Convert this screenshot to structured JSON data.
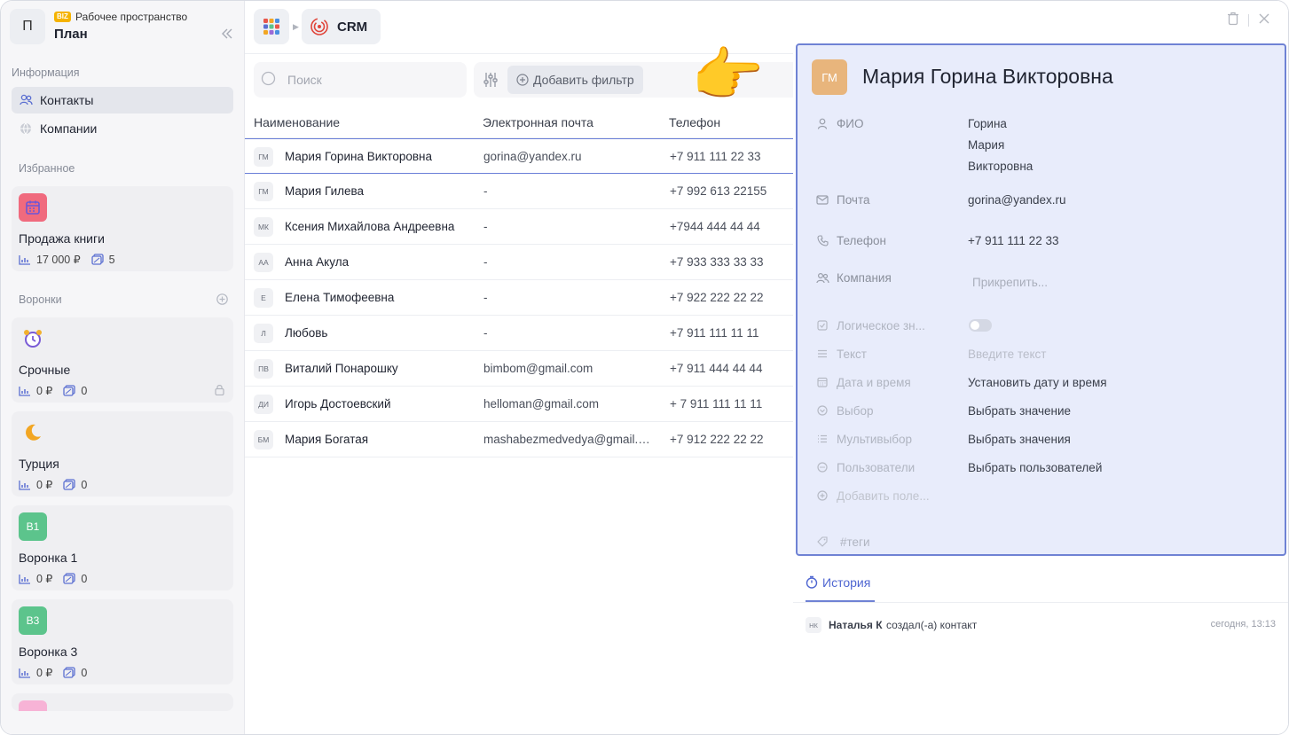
{
  "workspace": {
    "avatar": "П",
    "badge": "BIZ",
    "label": "Рабочее пространство",
    "name": "План"
  },
  "sidebar": {
    "info_title": "Информация",
    "nav": [
      {
        "label": "Контакты",
        "icon": "contacts-icon",
        "active": true
      },
      {
        "label": "Компании",
        "icon": "globe-icon",
        "active": false
      }
    ],
    "fav_title": "Избранное",
    "favorites": [
      {
        "title": "Продажа книги",
        "icon": "calendar-icon",
        "amount": "17 000 ₽",
        "count": "5"
      }
    ],
    "funnels_title": "Воронки",
    "funnels": [
      {
        "title": "Срочные",
        "icon": "alarm-clock-icon",
        "amount": "0 ₽",
        "count": "0",
        "locked": true
      },
      {
        "title": "Турция",
        "icon": "crescent-moon-icon",
        "amount": "0 ₽",
        "count": "0"
      },
      {
        "title": "Воронка 1",
        "badge": "В1",
        "amount": "0 ₽",
        "count": "0"
      },
      {
        "title": "Воронка 3",
        "badge": "В3",
        "amount": "0 ₽",
        "count": "0"
      }
    ]
  },
  "header": {
    "crm_label": "CRM"
  },
  "toolbar": {
    "search_placeholder": "Поиск",
    "add_filter": "Добавить фильтр"
  },
  "table": {
    "columns": [
      "Наименование",
      "Электронная почта",
      "Телефон"
    ],
    "rows": [
      {
        "ini": "ГМ",
        "name": "Мария Горина Викторовна",
        "email": "gorina@yandex.ru",
        "phone": "+7 911 111 22 33"
      },
      {
        "ini": "ГМ",
        "name": "Мария Гилева",
        "email": "-",
        "phone": "+7 992 613 22155"
      },
      {
        "ini": "МК",
        "name": "Ксения Михайлова Андреевна",
        "email": "-",
        "phone": "+7944 444 44 44"
      },
      {
        "ini": "АА",
        "name": "Анна Акула",
        "email": "-",
        "phone": "+7 933 333 33 33"
      },
      {
        "ini": "Е",
        "name": "Елена Тимофеевна",
        "email": "-",
        "phone": "+7 922 222 22 22"
      },
      {
        "ini": "Л",
        "name": "Любовь",
        "email": "-",
        "phone": "+7 911 111 11 11"
      },
      {
        "ini": "ПВ",
        "name": "Виталий Понарошку",
        "email": "bimbom@gmail.com",
        "phone": "+7 911 444 44 44"
      },
      {
        "ini": "ДИ",
        "name": "Игорь Достоевский",
        "email": "helloman@gmail.com",
        "phone": "+ 7 911 111 11 11"
      },
      {
        "ini": "БМ",
        "name": "Мария Богатая",
        "email": "mashabezmedvedya@gmail.com",
        "phone": "+7 912 222 22 22"
      }
    ]
  },
  "detail": {
    "avatar": "ГМ",
    "title": "Мария Горина Викторовна",
    "fio_label": "ФИО",
    "fio": [
      "Горина",
      "Мария",
      "Викторовна"
    ],
    "email_label": "Почта",
    "email": "gorina@yandex.ru",
    "phone_label": "Телефон",
    "phone": "+7 911 111 22 33",
    "company_label": "Компания",
    "company_action": "Прикрепить...",
    "bool_label": "Логическое зн...",
    "text_label": "Текст",
    "text_placeholder": "Введите текст",
    "datetime_label": "Дата и время",
    "datetime_action": "Установить дату и время",
    "select_label": "Выбор",
    "select_action": "Выбрать значение",
    "multiselect_label": "Мультивыбор",
    "multiselect_action": "Выбрать значения",
    "users_label": "Пользователи",
    "users_action": "Выбрать пользователей",
    "add_field": "Добавить поле...",
    "tags": "#теги"
  },
  "history": {
    "tab": "История",
    "entries": [
      {
        "ini": "НК",
        "who": "Наталья К",
        "action": "создал(-а) контакт",
        "time": "сегодня, 13:13"
      }
    ]
  },
  "colors": {
    "accent": "#6f82d4",
    "selection_bg": "#e8ecfb",
    "crm_red": "#e0463c",
    "badge_green": "#5cc48c"
  }
}
